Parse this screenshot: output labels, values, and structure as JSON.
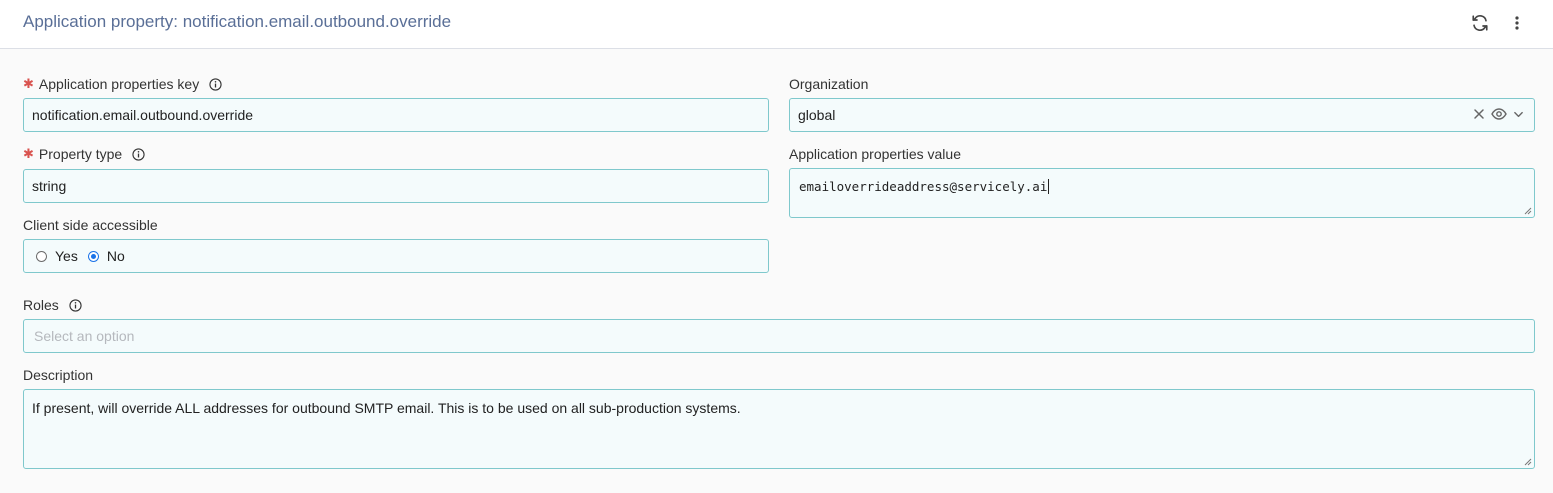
{
  "header": {
    "title": "Application property: notification.email.outbound.override",
    "icons": {
      "refresh": "refresh-icon",
      "more": "more-vertical-icon"
    }
  },
  "form": {
    "key": {
      "label": "Application properties key",
      "required": true,
      "value": "notification.email.outbound.override"
    },
    "organization": {
      "label": "Organization",
      "value": "global"
    },
    "property_type": {
      "label": "Property type",
      "required": true,
      "value": "string"
    },
    "value": {
      "label": "Application properties value",
      "value": "emailoverrideaddress@servicely.ai"
    },
    "client_side": {
      "label": "Client side accessible",
      "options": [
        {
          "label": "Yes",
          "checked": false
        },
        {
          "label": "No",
          "checked": true
        }
      ]
    },
    "roles": {
      "label": "Roles",
      "placeholder": "Select an option"
    },
    "description": {
      "label": "Description",
      "value": "If present, will override ALL addresses for outbound SMTP email. This is to be used on all sub-production systems."
    }
  },
  "colors": {
    "accent": "#1a73e8",
    "field_border": "#7fc8cc",
    "field_bg": "#f4fbfc",
    "required": "#d9534f",
    "title": "#5a6f97"
  }
}
